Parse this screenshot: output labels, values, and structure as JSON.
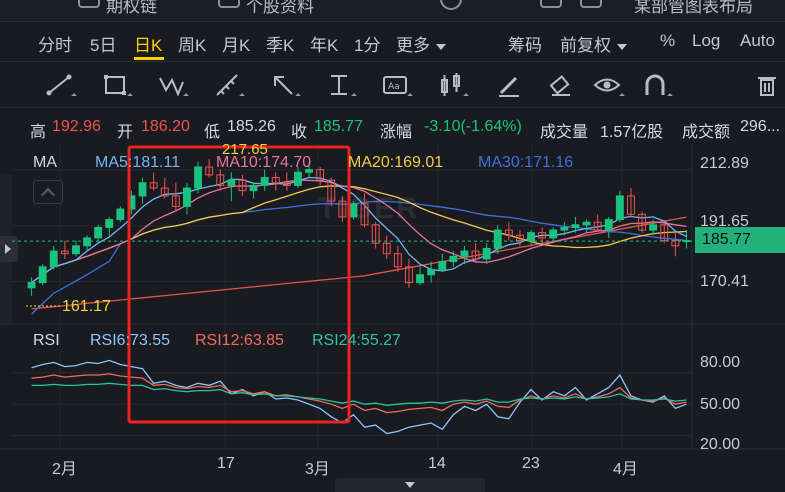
{
  "top_strip": {
    "item1": "期权链",
    "item2": "个股资料",
    "item3": "某部管图表布局"
  },
  "periods": [
    {
      "label": "分时",
      "active": false
    },
    {
      "label": "5日",
      "active": false
    },
    {
      "label": "日K",
      "active": true
    },
    {
      "label": "周K",
      "active": false
    },
    {
      "label": "月K",
      "active": false
    },
    {
      "label": "季K",
      "active": false
    },
    {
      "label": "年K",
      "active": false
    },
    {
      "label": "1分",
      "active": false
    },
    {
      "label": "更多",
      "active": false
    }
  ],
  "period_right": {
    "chips": "筹码",
    "adjust": "前复权",
    "percent": "%",
    "log": "Log",
    "auto": "Auto"
  },
  "tools": [
    "line-tool-icon",
    "rect-tool-icon",
    "wave-tool-icon",
    "measure-tool-icon",
    "arrow-tool-icon",
    "text-range-tool-icon",
    "text-label-tool-icon",
    "candle-tool-icon",
    "pen-icon",
    "eraser-icon",
    "eye-icon",
    "magnet-icon",
    "trash-icon"
  ],
  "quote": {
    "high_label": "高",
    "high": "192.96",
    "open_label": "开",
    "open": "186.20",
    "low_label": "低",
    "low": "185.26",
    "close_label": "收",
    "close": "185.77",
    "change_label": "涨幅",
    "change": "-3.10(-1.64%)",
    "volume_label": "成交量",
    "volume": "1.57亿股",
    "amount_label": "成交额",
    "amount": "296..."
  },
  "ma_legend": {
    "title": "MA",
    "ma5": "MA5:181.11",
    "ma10": "MA10:174.70",
    "ma20": "MA20:169.01",
    "ma30": "MA30:171.16"
  },
  "rsi_legend": {
    "title": "RSI",
    "rsi6": "RSI6:73.55",
    "rsi12": "RSI12:63.85",
    "rsi24": "RSI24:55.27"
  },
  "price_axis": {
    "current": "185.77",
    "t1": "212.89",
    "t2": "191.65",
    "t3": "170.41"
  },
  "rsi_axis": {
    "t1": "80.00",
    "t2": "50.00",
    "t3": "20.00"
  },
  "date_axis": [
    "2月",
    "17",
    "3月",
    "14",
    "23",
    "4月"
  ],
  "annotations": {
    "low_marker": "161.17",
    "high_marker": "217.65",
    "watermark": "TIGER"
  },
  "colors": {
    "up": "#ef5350",
    "down": "#19c37d",
    "ma5": "#6fb6f5",
    "ma10": "#e8739b",
    "ma20": "#f2c94c",
    "ma30": "#3d6fe0",
    "ma60": "#e0544a",
    "rsi6": "#8ec5ff",
    "rsi12": "#ef6b5b",
    "rsi24": "#2bc3a4",
    "highlight": "#e8241e",
    "accent": "#ffd000"
  },
  "chart_data": [
    {
      "type": "candlestick",
      "ylim": [
        155,
        222
      ],
      "series": [
        {
          "name": "candles",
          "values": [
            [
              168,
              172,
              165,
              170
            ],
            [
              170,
              177,
              169,
              176
            ],
            [
              176,
              184,
              175,
              182
            ],
            [
              182,
              186,
              179,
              181
            ],
            [
              181,
              186,
              180,
              184
            ],
            [
              184,
              188,
              182,
              187
            ],
            [
              187,
              192,
              185,
              191
            ],
            [
              191,
              195,
              188,
              194
            ],
            [
              194,
              199,
              193,
              198
            ],
            [
              198,
              205,
              196,
              203
            ],
            [
              203,
              210,
              200,
              208
            ],
            [
              208,
              212,
              205,
              206
            ],
            [
              206,
              210,
              202,
              203
            ],
            [
              203,
              208,
              197,
              199
            ],
            [
              199,
              208,
              196,
              206
            ],
            [
              206,
              216,
              204,
              214
            ],
            [
              214,
              217,
              210,
              211
            ],
            [
              211,
              213,
              205,
              207
            ],
            [
              207,
              212,
              201,
              209
            ],
            [
              209,
              211,
              203,
              205
            ],
            [
              205,
              208,
              202,
              207
            ],
            [
              207,
              213,
              205,
              210
            ],
            [
              210,
              212,
              205,
              208
            ],
            [
              208,
              212,
              205,
              207
            ],
            [
              207,
              214,
              206,
              212
            ],
            [
              212,
              216,
              210,
              213
            ],
            [
              213,
              214,
              207,
              209
            ],
            [
              209,
              210,
              199,
              201
            ],
            [
              201,
              203,
              193,
              195
            ],
            [
              195,
              201,
              194,
              200
            ],
            [
              200,
              204,
              191,
              192
            ],
            [
              192,
              193,
              183,
              185
            ],
            [
              185,
              188,
              179,
              181
            ],
            [
              181,
              184,
              174,
              176
            ],
            [
              176,
              179,
              168,
              170
            ],
            [
              170,
              176,
              169,
              173
            ],
            [
              173,
              178,
              170,
              175
            ],
            [
              175,
              181,
              174,
              178
            ],
            [
              178,
              182,
              176,
              180
            ],
            [
              180,
              184,
              177,
              182
            ],
            [
              182,
              185,
              178,
              179
            ],
            [
              179,
              185,
              177,
              183
            ],
            [
              183,
              192,
              181,
              190
            ],
            [
              190,
              193,
              186,
              188
            ],
            [
              188,
              190,
              184,
              186
            ],
            [
              186,
              190,
              184,
              189
            ],
            [
              189,
              191,
              185,
              187
            ],
            [
              187,
              191,
              186,
              190
            ],
            [
              190,
              193,
              188,
              191
            ],
            [
              191,
              195,
              189,
              192
            ],
            [
              192,
              194,
              189,
              193
            ],
            [
              193,
              196,
              190,
              190
            ],
            [
              190,
              195,
              187,
              194
            ],
            [
              194,
              205,
              193,
              203
            ],
            [
              203,
              206,
              195,
              196
            ],
            [
              196,
              197,
              189,
              190
            ],
            [
              190,
              194,
              188,
              192
            ],
            [
              192,
              193,
              185,
              186
            ],
            [
              186,
              189,
              180,
              184
            ],
            [
              186,
              190,
              183,
              186
            ]
          ]
        },
        {
          "name": "ma_overlays",
          "values": []
        }
      ]
    },
    {
      "type": "line",
      "ylim": [
        10,
        100
      ],
      "series": [
        {
          "name": "RSI6",
          "values": [
            85,
            88,
            90,
            86,
            87,
            90,
            89,
            92,
            88,
            86,
            84,
            70,
            72,
            68,
            66,
            70,
            68,
            72,
            60,
            64,
            58,
            62,
            55,
            56,
            54,
            50,
            46,
            38,
            32,
            40,
            28,
            30,
            22,
            24,
            28,
            30,
            32,
            26,
            40,
            48,
            44,
            50,
            38,
            36,
            52,
            64,
            54,
            62,
            58,
            66,
            54,
            60,
            66,
            78,
            58,
            54,
            52,
            58,
            46,
            50
          ]
        },
        {
          "name": "RSI12",
          "values": [
            75,
            76,
            78,
            76,
            77,
            78,
            78,
            79,
            77,
            76,
            75,
            68,
            69,
            66,
            65,
            67,
            66,
            68,
            62,
            63,
            60,
            62,
            58,
            59,
            57,
            55,
            53,
            50,
            46,
            50,
            44,
            46,
            42,
            43,
            45,
            46,
            47,
            44,
            50,
            52,
            50,
            53,
            48,
            47,
            54,
            58,
            55,
            58,
            56,
            60,
            55,
            57,
            60,
            66,
            56,
            54,
            53,
            56,
            50,
            52
          ]
        },
        {
          "name": "RSI24",
          "values": [
            68,
            68,
            69,
            68,
            68,
            69,
            69,
            70,
            69,
            68,
            68,
            64,
            65,
            63,
            62,
            63,
            63,
            64,
            60,
            61,
            59,
            60,
            58,
            58,
            57,
            56,
            55,
            53,
            51,
            53,
            50,
            51,
            49,
            50,
            51,
            51,
            52,
            51,
            53,
            54,
            53,
            55,
            52,
            52,
            55,
            56,
            55,
            56,
            55,
            57,
            55,
            56,
            57,
            60,
            55,
            54,
            54,
            55,
            53,
            54
          ]
        }
      ]
    }
  ]
}
